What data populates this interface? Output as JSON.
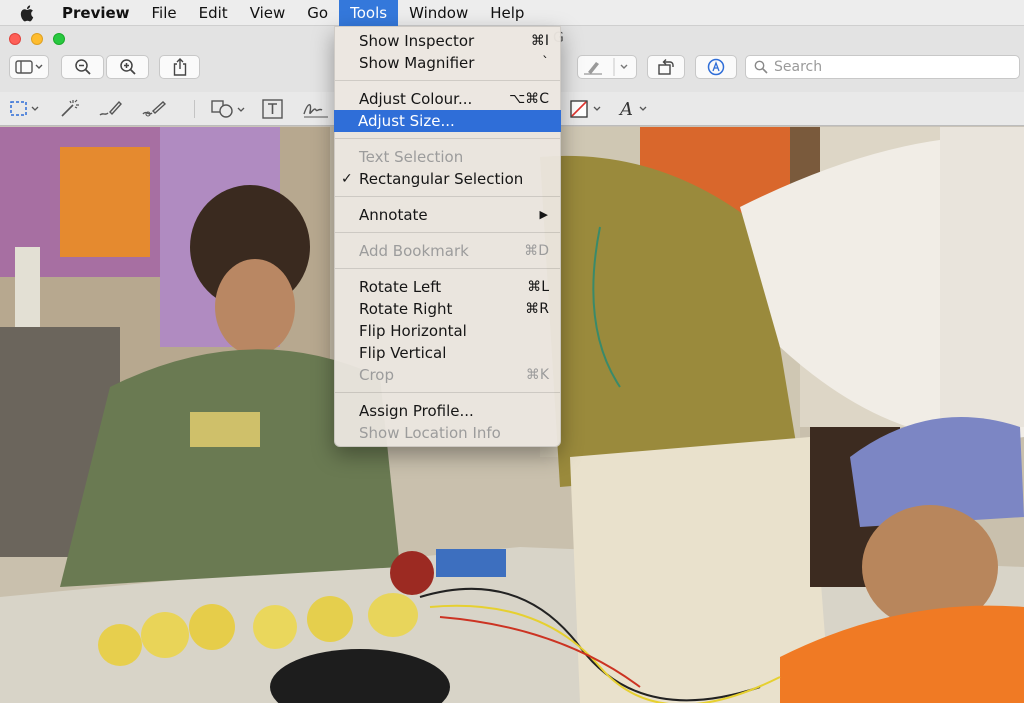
{
  "menubar": {
    "app_name": "Preview",
    "items": [
      "File",
      "Edit",
      "View",
      "Go",
      "Tools",
      "Window",
      "Help"
    ]
  },
  "toolbar": {
    "title_fragment": "G",
    "search_placeholder": "Search"
  },
  "tools_menu": {
    "show_inspector": {
      "label": "Show Inspector",
      "shortcut": "⌘I"
    },
    "show_magnifier": {
      "label": "Show Magnifier",
      "shortcut": "`"
    },
    "adjust_colour": {
      "label": "Adjust Colour...",
      "shortcut": "⌥⌘C"
    },
    "adjust_size": {
      "label": "Adjust Size..."
    },
    "text_selection": {
      "label": "Text Selection"
    },
    "rectangular_selection": {
      "label": "Rectangular Selection",
      "check": "✓"
    },
    "annotate": {
      "label": "Annotate",
      "arrow": "▶"
    },
    "add_bookmark": {
      "label": "Add Bookmark",
      "shortcut": "⌘D"
    },
    "rotate_left": {
      "label": "Rotate Left",
      "shortcut": "⌘L"
    },
    "rotate_right": {
      "label": "Rotate Right",
      "shortcut": "⌘R"
    },
    "flip_horizontal": {
      "label": "Flip Horizontal"
    },
    "flip_vertical": {
      "label": "Flip Vertical"
    },
    "crop": {
      "label": "Crop",
      "shortcut": "⌘K"
    },
    "assign_profile": {
      "label": "Assign Profile..."
    },
    "show_location_info": {
      "label": "Show Location Info"
    }
  },
  "colors": {
    "menu_highlight": "#2f6ed8",
    "menubar_active": "#3478db"
  }
}
